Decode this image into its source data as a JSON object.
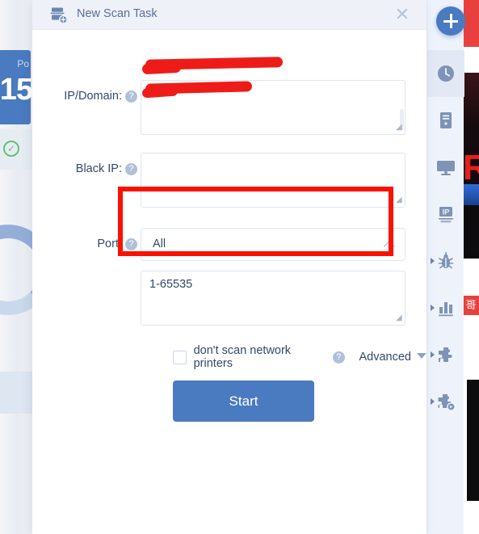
{
  "background": {
    "stat_card": {
      "label": "Po",
      "value": "15"
    },
    "check_icon": "check-circle-icon",
    "donut": "progress-donut-chart",
    "right_page_tag": "哥",
    "right_hero_letter": "R"
  },
  "tool_sidebar": {
    "add_button": {
      "name": "add-task-fab",
      "glyph": "plus"
    },
    "items": [
      {
        "name": "sidebar-item-history",
        "icon": "clock-icon",
        "active": true,
        "expandable": false
      },
      {
        "name": "sidebar-item-server",
        "icon": "server-tower-icon",
        "active": false,
        "expandable": false
      },
      {
        "name": "sidebar-item-monitor",
        "icon": "monitor-icon",
        "active": false,
        "expandable": false
      },
      {
        "name": "sidebar-item-ip",
        "icon": "ip-icon",
        "label": "IP",
        "active": false,
        "expandable": false
      },
      {
        "name": "sidebar-item-vulnerability",
        "icon": "bug-icon",
        "active": false,
        "expandable": true
      },
      {
        "name": "sidebar-item-statistics",
        "icon": "bar-chart-icon",
        "active": false,
        "expandable": true
      },
      {
        "name": "sidebar-item-plugins",
        "icon": "puzzle-icon",
        "active": false,
        "expandable": true
      },
      {
        "name": "sidebar-item-plugin-run",
        "icon": "puzzle-play-icon",
        "active": false,
        "expandable": true
      }
    ]
  },
  "dialog": {
    "title": "New Scan Task",
    "icon": "new-scan-task-icon",
    "close_label": "✕",
    "help_glyph": "?",
    "fields": {
      "ip_domain": {
        "label": "IP/Domain:",
        "value": "",
        "placeholder": "",
        "redacted": true
      },
      "black_ip": {
        "label": "Black IP:",
        "value": "",
        "placeholder": ""
      },
      "port": {
        "label": "Port:",
        "selected": "All",
        "range_value": "1-65535",
        "range_placeholder": ""
      }
    },
    "checkbox": {
      "label": "don't scan network printers",
      "checked": false
    },
    "advanced": {
      "label": "Advanced"
    },
    "start_button": {
      "label": "Start"
    }
  },
  "annotations": {
    "port_highlight_color": "#fb1100",
    "redaction_color": "#ee1c18"
  },
  "colors": {
    "accent_blue": "#4a7ac0",
    "header_bg": "#eef1f8",
    "text_navy": "#33486a",
    "border_grey": "#dfe5ee",
    "sidebar_bg": "#eef3fb"
  }
}
